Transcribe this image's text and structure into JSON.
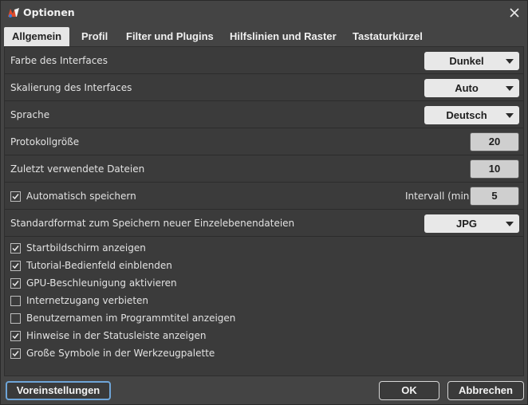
{
  "window": {
    "title": "Optionen",
    "app_icon": "photo-editor-logo-icon",
    "close_icon": "close-icon"
  },
  "tabs": [
    {
      "label": "Allgemein",
      "active": true
    },
    {
      "label": "Profil",
      "active": false
    },
    {
      "label": "Filter und Plugins",
      "active": false
    },
    {
      "label": "Hilfslinien und Raster",
      "active": false
    },
    {
      "label": "Tastaturkürzel",
      "active": false
    }
  ],
  "settings": {
    "interface_color": {
      "label": "Farbe des Interfaces",
      "value": "Dunkel"
    },
    "interface_scale": {
      "label": "Skalierung des Interfaces",
      "value": "Auto"
    },
    "language": {
      "label": "Sprache",
      "value": "Deutsch"
    },
    "history_size": {
      "label": "Protokollgröße",
      "value": "20"
    },
    "recent_files": {
      "label": "Zuletzt verwendete Dateien",
      "value": "10"
    },
    "autosave": {
      "label": "Automatisch speichern",
      "checked": true,
      "interval_label": "Intervall (min)",
      "interval_value": "5"
    },
    "default_format": {
      "label": "Standardformat zum Speichern neuer Einzelebenendateien",
      "value": "JPG"
    }
  },
  "checkboxes": [
    {
      "label": "Startbildschirm anzeigen",
      "checked": true
    },
    {
      "label": "Tutorial-Bedienfeld einblenden",
      "checked": true
    },
    {
      "label": "GPU-Beschleunigung aktivieren",
      "checked": true
    },
    {
      "label": "Internetzugang verbieten",
      "checked": false
    },
    {
      "label": "Benutzernamen im Programmtitel anzeigen",
      "checked": false
    },
    {
      "label": "Hinweise in der Statusleiste anzeigen",
      "checked": true
    },
    {
      "label": "Große Symbole in der Werkzeugpalette",
      "checked": true
    }
  ],
  "footer": {
    "defaults_label": "Voreinstellungen",
    "ok_label": "OK",
    "cancel_label": "Abbrechen"
  },
  "colors": {
    "background": "#444444",
    "panel": "#3b3b3b",
    "active_tab": "#e6e6e6",
    "focus_ring": "#6ea5d8"
  }
}
